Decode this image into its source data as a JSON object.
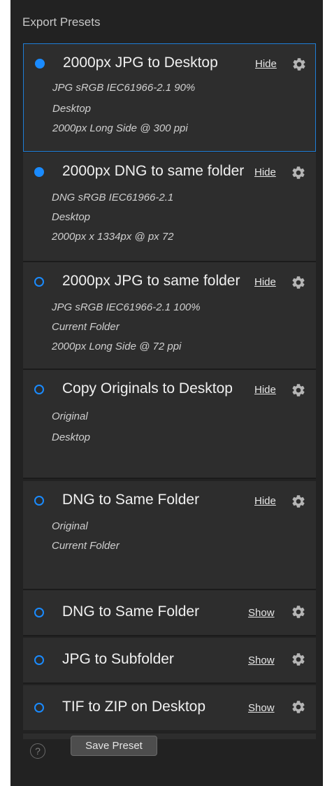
{
  "panel": {
    "title": "Export Presets"
  },
  "presets": [
    {
      "name": "2000px JPG to Desktop",
      "toggle": "Hide",
      "details": [
        "JPG  sRGB IEC61966-2.1  90%",
        "Desktop",
        "2000px Long Side @ 300 ppi"
      ]
    },
    {
      "name": "2000px DNG to same folder",
      "toggle": "Hide",
      "details": [
        "DNG  sRGB IEC61966-2.1",
        "Desktop",
        "2000px x 1334px @ px 72"
      ]
    },
    {
      "name": "2000px JPG to same folder",
      "toggle": "Hide",
      "details": [
        "JPG  sRGB IEC61966-2.1  100%",
        "Current Folder",
        "2000px Long Side @ 72 ppi"
      ]
    },
    {
      "name": "Copy Originals to Desktop",
      "toggle": "Hide",
      "details": [
        "Original",
        "Desktop"
      ]
    },
    {
      "name": "DNG to Same Folder",
      "toggle": "Hide",
      "details": [
        "Original",
        "Current Folder"
      ]
    },
    {
      "name": "DNG to Same Folder",
      "toggle": "Show",
      "details": []
    },
    {
      "name": "JPG to Subfolder",
      "toggle": "Show",
      "details": []
    },
    {
      "name": "TIF to ZIP on Desktop",
      "toggle": "Show",
      "details": []
    }
  ],
  "footer": {
    "help_label": "?",
    "save_label": "Save Preset"
  },
  "colors": {
    "accent": "#1a8bff",
    "selection_border": "#1e7fd8",
    "panel_bg": "#222222",
    "item_bg": "#2d2d2d"
  },
  "icons": {
    "preset_settings": "gear-icon",
    "help": "help-icon"
  }
}
